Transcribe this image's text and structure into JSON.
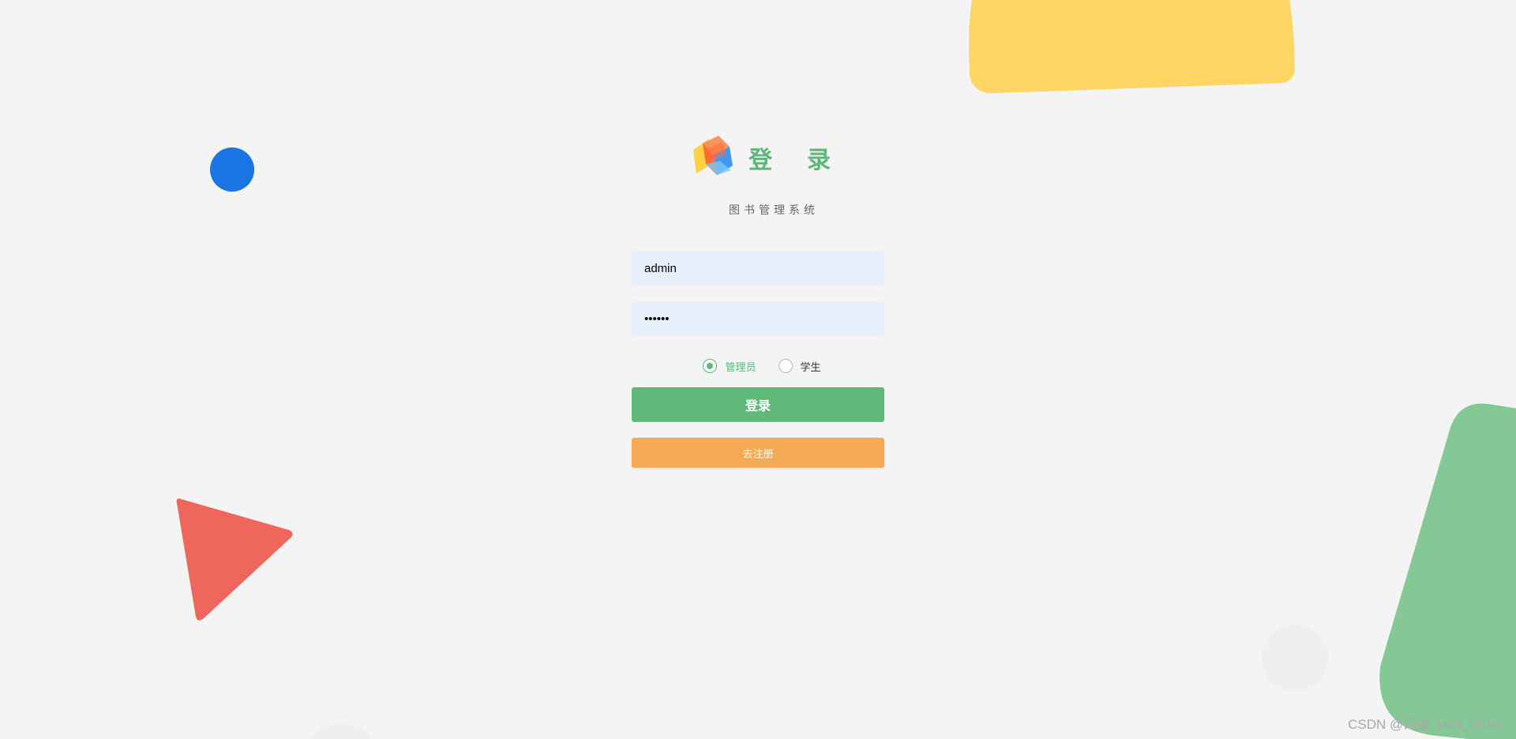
{
  "app": {
    "title": "登录",
    "subtitle": "图书管理系统"
  },
  "form": {
    "username_value": "admin",
    "password_value": "123456",
    "roles": [
      {
        "label": "管理员",
        "selected": true
      },
      {
        "label": "学生",
        "selected": false
      }
    ],
    "login_label": "登录",
    "register_label": "去注册"
  },
  "watermark": "CSDN @码盗_java_bishe",
  "colors": {
    "background": "#f4f4f4",
    "accent_green": "#5fba7a",
    "register_orange": "#f5ab55",
    "input_bg": "#e8f0fe",
    "shape_yellow": "#ffd664",
    "shape_blue": "#1b74e4",
    "shape_red": "#ef665c",
    "shape_green": "#84c995"
  },
  "icons": {
    "logo": "cube-logo-icon",
    "radio": "radio-icon"
  }
}
